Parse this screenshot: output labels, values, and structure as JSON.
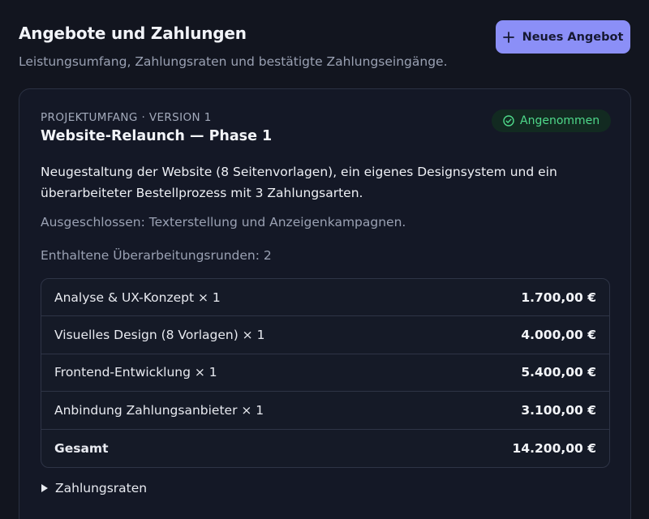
{
  "header": {
    "title": "Angebote und Zahlungen",
    "subtitle": "Leistungsumfang, Zahlungsraten und bestätigte Zahlungseingänge.",
    "new_button_label": "Neues Angebot"
  },
  "offer": {
    "eyebrow": "PROJEKTUMFANG · VERSION 1",
    "title": "Website-Relaunch — Phase 1",
    "status": "Angenommen",
    "description": "Neugestaltung der Website (8 Seitenvorlagen), ein eigenes Designsystem und ein überarbeiteter Bestellprozess mit 3 Zahlungsarten.",
    "excluded": "Ausgeschlossen: Texterstellung und Anzeigenkampagnen.",
    "revisions": "Enthaltene Überarbeitungsrunden: 2",
    "line_items": [
      {
        "label": "Analyse & UX-Konzept × 1",
        "amount": "1.700,00 €"
      },
      {
        "label": "Visuelles Design (8 Vorlagen) × 1",
        "amount": "4.000,00 €"
      },
      {
        "label": "Frontend-Entwicklung × 1",
        "amount": "5.400,00 €"
      },
      {
        "label": "Anbindung Zahlungsanbieter × 1",
        "amount": "3.100,00 €"
      }
    ],
    "total": {
      "label": "Gesamt",
      "amount": "14.200,00 €"
    },
    "installments_label": "Zahlungsraten"
  },
  "colors": {
    "background": "#12151f",
    "accent": "#8b8ff7",
    "success": "#4fd98b"
  }
}
